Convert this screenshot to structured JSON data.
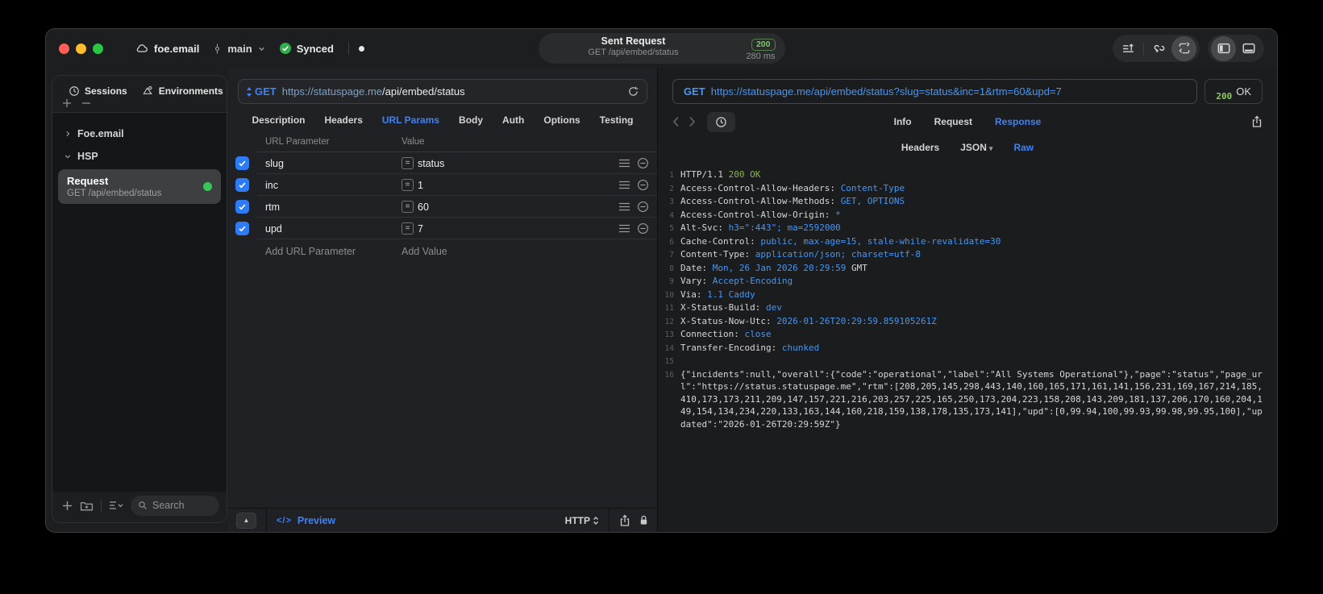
{
  "titlebar": {
    "project": "foe.email",
    "branch": "main",
    "sync_label": "Synced",
    "request_summary": {
      "title": "Sent Request",
      "subtitle": "GET /api/embed/status",
      "status": "200",
      "time": "280 ms"
    }
  },
  "sidebar": {
    "tabs": [
      {
        "label": "Sessions"
      },
      {
        "label": "Environments"
      }
    ],
    "groups": [
      {
        "label": "Foe.email",
        "expanded": false
      },
      {
        "label": "HSP",
        "expanded": true
      }
    ],
    "request_item": {
      "title": "Request",
      "subtitle": "GET /api/embed/status"
    },
    "search": {
      "placeholder": "Search"
    }
  },
  "request_editor": {
    "method": "GET",
    "url": {
      "host": "https://statuspage.me",
      "path": "/api/embed/status"
    },
    "tabs": [
      "Description",
      "Headers",
      "URL Params",
      "Body",
      "Auth",
      "Options",
      "Testing"
    ],
    "active_tab": "URL Params",
    "params": {
      "columns": [
        "URL Parameter",
        "Value"
      ],
      "rows": [
        {
          "name": "slug",
          "value": "status",
          "enabled": true
        },
        {
          "name": "inc",
          "value": "1",
          "enabled": true
        },
        {
          "name": "rtm",
          "value": "60",
          "enabled": true
        },
        {
          "name": "upd",
          "value": "7",
          "enabled": true
        }
      ],
      "add_row": {
        "name_placeholder": "Add URL Parameter",
        "value_placeholder": "Add Value"
      }
    },
    "footer": {
      "preview": "Preview",
      "protocol": "HTTP"
    }
  },
  "response_viewer": {
    "request_line": {
      "method": "GET",
      "url": "https://statuspage.me/api/embed/status?slug=status&inc=1&rtm=60&upd=7"
    },
    "status": {
      "code": "200",
      "label": "OK"
    },
    "tabs": [
      "Info",
      "Request",
      "Response"
    ],
    "active_tab": "Response",
    "view_tabs": [
      "Headers",
      "JSON",
      "Raw"
    ],
    "active_view_tab": "Raw",
    "body_lines": [
      {
        "num": 1,
        "segments": [
          {
            "t": "HTTP/1.1 ",
            "c": "p"
          },
          {
            "t": "200 OK",
            "c": "g"
          }
        ]
      },
      {
        "num": 2,
        "segments": [
          {
            "t": "Access-Control-Allow-Headers: ",
            "c": "p"
          },
          {
            "t": "Content-Type",
            "c": "b"
          }
        ]
      },
      {
        "num": 3,
        "segments": [
          {
            "t": "Access-Control-Allow-Methods: ",
            "c": "p"
          },
          {
            "t": "GET, OPTIONS",
            "c": "b"
          }
        ]
      },
      {
        "num": 4,
        "segments": [
          {
            "t": "Access-Control-Allow-Origin: ",
            "c": "p"
          },
          {
            "t": "*",
            "c": "b"
          }
        ]
      },
      {
        "num": 5,
        "segments": [
          {
            "t": "Alt-Svc: ",
            "c": "p"
          },
          {
            "t": "h3=\":443\"; ma=2592000",
            "c": "b"
          }
        ]
      },
      {
        "num": 6,
        "segments": [
          {
            "t": "Cache-Control: ",
            "c": "p"
          },
          {
            "t": "public, max-age=15, stale-while-revalidate=30",
            "c": "b"
          }
        ]
      },
      {
        "num": 7,
        "segments": [
          {
            "t": "Content-Type: ",
            "c": "p"
          },
          {
            "t": "application/json; charset=utf-8",
            "c": "b"
          }
        ]
      },
      {
        "num": 8,
        "segments": [
          {
            "t": "Date: ",
            "c": "p"
          },
          {
            "t": "Mon, 26 Jan 2026 20:29:59",
            "c": "b"
          },
          {
            "t": " GMT",
            "c": "p"
          }
        ]
      },
      {
        "num": 9,
        "segments": [
          {
            "t": "Vary: ",
            "c": "p"
          },
          {
            "t": "Accept-Encoding",
            "c": "b"
          }
        ]
      },
      {
        "num": 10,
        "segments": [
          {
            "t": "Via: ",
            "c": "p"
          },
          {
            "t": "1.1 Caddy",
            "c": "b"
          }
        ]
      },
      {
        "num": 11,
        "segments": [
          {
            "t": "X-Status-Build: ",
            "c": "p"
          },
          {
            "t": "dev",
            "c": "b"
          }
        ]
      },
      {
        "num": 12,
        "segments": [
          {
            "t": "X-Status-Now-Utc: ",
            "c": "p"
          },
          {
            "t": "2026-01-26T20:29:59.859105261Z",
            "c": "b"
          }
        ]
      },
      {
        "num": 13,
        "segments": [
          {
            "t": "Connection: ",
            "c": "p"
          },
          {
            "t": "close",
            "c": "b"
          }
        ]
      },
      {
        "num": 14,
        "segments": [
          {
            "t": "Transfer-Encoding: ",
            "c": "p"
          },
          {
            "t": "chunked",
            "c": "b"
          }
        ]
      },
      {
        "num": 15,
        "segments": []
      },
      {
        "num": 16,
        "segments": [
          {
            "t": "{\"incidents\":null,\"overall\":{\"code\":\"operational\",\"label\":\"All Systems Operational\"},\"page\":\"status\",\"page_url\":\"https://status.statuspage.me\",\"rtm\":[208,205,145,298,443,140,160,165,171,161,141,156,231,169,167,214,185,410,173,173,211,209,147,157,221,216,203,257,225,165,250,173,204,223,158,208,143,209,181,137,206,170,160,204,149,154,134,234,220,133,163,144,160,218,159,138,178,135,173,141],\"upd\":[0,99.94,100,99.93,99.98,99.95,100],\"updated\":\"2026-01-26T20:29:59Z\"}",
            "c": "p"
          }
        ]
      }
    ]
  },
  "colors": {
    "accent_blue": "#3d82f7",
    "code_value_blue": "#4596f5",
    "code_green": "#8ab446",
    "status_green_badge": "#7fc56f",
    "checkbox_blue": "#2e7bf6",
    "selected_item_bg": "#3e3f41",
    "window_bg": "#202123",
    "outer_bg": "#000000"
  }
}
